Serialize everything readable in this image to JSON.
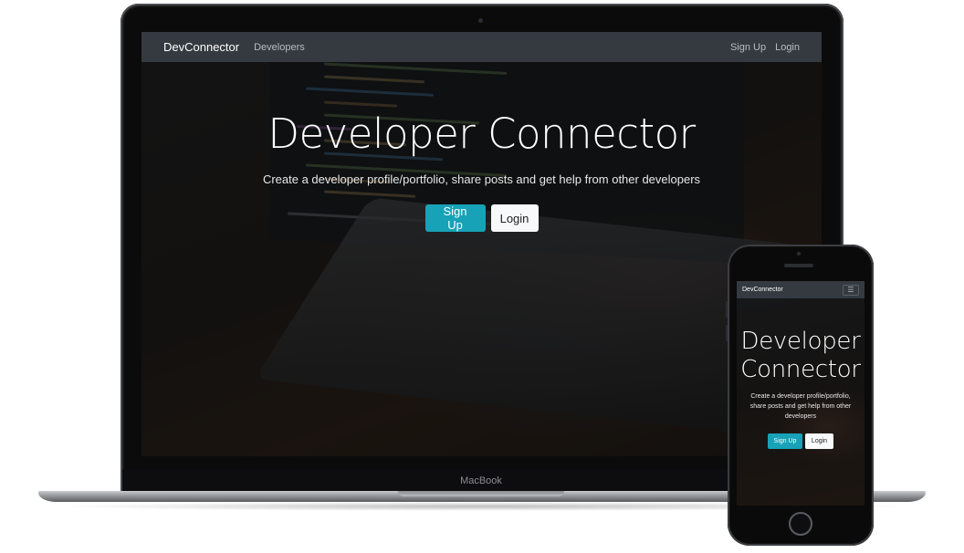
{
  "laptop": {
    "device_label": "MacBook",
    "navbar": {
      "brand": "DevConnector",
      "links": [
        "Developers"
      ],
      "right_links": [
        "Sign Up",
        "Login"
      ]
    },
    "hero": {
      "title": "Developer Connector",
      "subtitle": "Create a developer profile/portfolio, share posts and get help from other developers",
      "primary_button": "Sign Up",
      "secondary_button": "Login"
    }
  },
  "phone": {
    "navbar": {
      "brand": "DevConnector",
      "toggler_icon": "hamburger-menu-icon"
    },
    "hero": {
      "title_line1": "Developer",
      "title_line2": "Connector",
      "subtitle": "Create a developer profile/portfolio, share posts and get help from other developers",
      "primary_button": "Sign Up",
      "secondary_button": "Login"
    }
  },
  "colors": {
    "navbar_bg": "#343a40",
    "primary": "#17a2b8",
    "light": "#f8f9fa"
  }
}
